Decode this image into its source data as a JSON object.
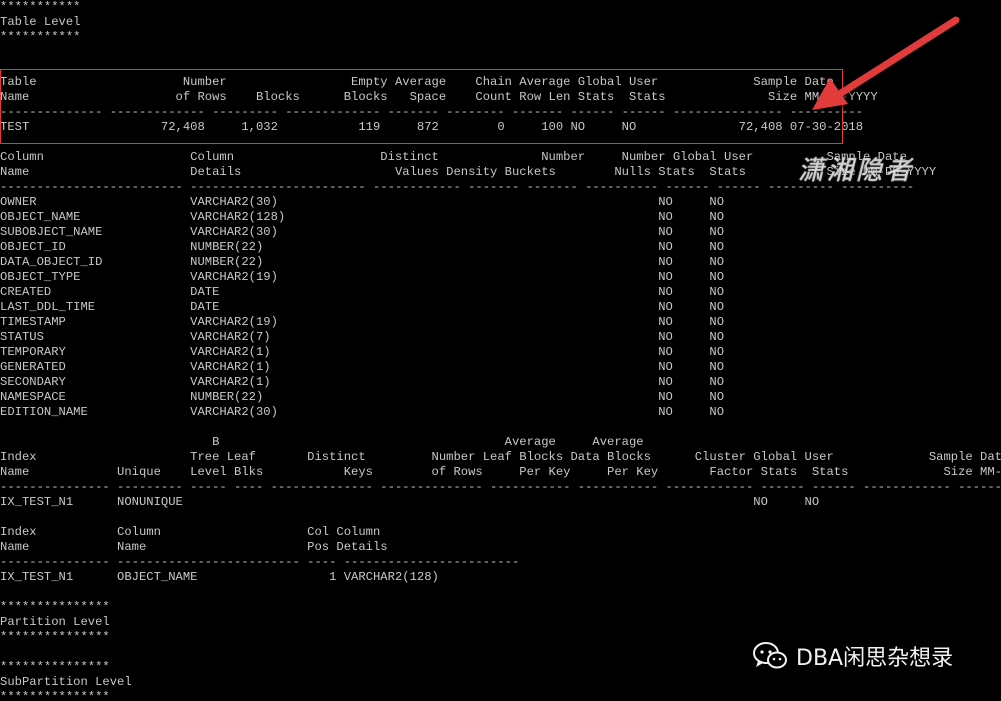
{
  "terminal": {
    "lines": [
      "***********",
      "Table Level",
      "***********",
      "",
      "",
      "Table                    Number                 Empty Average    Chain Average Global User             Sample Date",
      "Name                    of Rows    Blocks      Blocks   Space    Count Row Len Stats  Stats              Size MM-DD-YYYY",
      "-------------- ------------- --------- ------------- ------- -------- ------- ------ ------ --------------- ----------",
      "TEST                  72,408     1,032           119     872        0     100 NO     NO              72,408 07-30-2018",
      "",
      "Column                    Column                    Distinct              Number     Number Global User          Sample Date",
      "Name                      Details                     Values Density Buckets        Nulls Stats  Stats           Size MM-DD-YYYY",
      "------------------------- ------------------------ ------------ ------- ------- ---------- ------ ------ --------- ----------",
      "OWNER                     VARCHAR2(30)                                                    NO     NO",
      "OBJECT_NAME               VARCHAR2(128)                                                   NO     NO",
      "SUBOBJECT_NAME            VARCHAR2(30)                                                    NO     NO",
      "OBJECT_ID                 NUMBER(22)                                                      NO     NO",
      "DATA_OBJECT_ID            NUMBER(22)                                                      NO     NO",
      "OBJECT_TYPE               VARCHAR2(19)                                                    NO     NO",
      "CREATED                   DATE                                                            NO     NO",
      "LAST_DDL_TIME             DATE                                                            NO     NO",
      "TIMESTAMP                 VARCHAR2(19)                                                    NO     NO",
      "STATUS                    VARCHAR2(7)                                                     NO     NO",
      "TEMPORARY                 VARCHAR2(1)                                                     NO     NO",
      "GENERATED                 VARCHAR2(1)                                                     NO     NO",
      "SECONDARY                 VARCHAR2(1)                                                     NO     NO",
      "NAMESPACE                 NUMBER(22)                                                      NO     NO",
      "EDITION_NAME              VARCHAR2(30)                                                    NO     NO",
      "",
      "                             B                                       Average     Average",
      "Index                     Tree Leaf       Distinct         Number Leaf Blocks Data Blocks      Cluster Global User             Sample Date",
      "Name            Unique    Level Blks           Keys        of Rows     Per Key     Per Key       Factor Stats  Stats             Size MM-DD-YYYY",
      "--------------- --------- ----- ---- -------------- -------------- ----------- ----------- ------------ ------ ------ ------------ ----------",
      "IX_TEST_N1      NONUNIQUE                                                                              NO     NO",
      "",
      "Index           Column                    Col Column",
      "Name            Name                      Pos Details",
      "--------------- ------------------------- ---- ------------------------",
      "IX_TEST_N1      OBJECT_NAME                  1 VARCHAR2(128)",
      "",
      "***************",
      "Partition Level",
      "***************",
      "",
      "***************",
      "SubPartition Level",
      "***************"
    ]
  },
  "watermark": "潇湘隐者",
  "brand": {
    "name": "DBA闲思杂想录",
    "icon": "wechat-icon"
  },
  "colors": {
    "background": "#000000",
    "text": "#c8c8c8",
    "highlight": "#e23a3a"
  }
}
